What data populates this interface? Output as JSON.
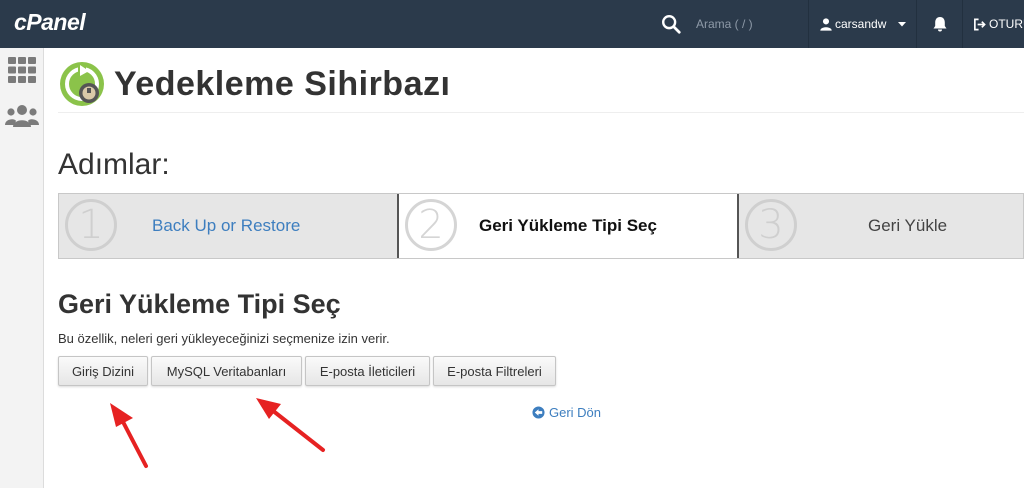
{
  "header": {
    "logo": "cPanel",
    "search_placeholder": "Arama ( / )",
    "username": "carsandw",
    "logout_label": "OTURUM"
  },
  "sidebar": {
    "items": [
      {
        "icon": "grid-icon"
      },
      {
        "icon": "users-icon"
      }
    ]
  },
  "page": {
    "title": "Yedekleme Sihirbazı",
    "steps_heading": "Adımlar:",
    "steps": [
      {
        "number": "1",
        "label": "Back Up or Restore",
        "state": "link"
      },
      {
        "number": "2",
        "label": "Geri Yükleme Tipi Seç",
        "state": "active"
      },
      {
        "number": "3",
        "label": "Geri Yükle",
        "state": "pending"
      }
    ],
    "section_title": "Geri Yükleme Tipi Seç",
    "section_description": "Bu özellik, neleri geri yükleyeceğinizi seçmenize izin verir.",
    "buttons": [
      {
        "label": "Giriş Dizini"
      },
      {
        "label": "MySQL Veritabanları"
      },
      {
        "label": "E-posta İleticileri"
      },
      {
        "label": "E-posta Filtreleri"
      }
    ],
    "back_label": "Geri Dön"
  },
  "colors": {
    "topbar": "#2b3a4b",
    "link": "#3d7ebf",
    "annotation_arrow": "#e62222"
  }
}
